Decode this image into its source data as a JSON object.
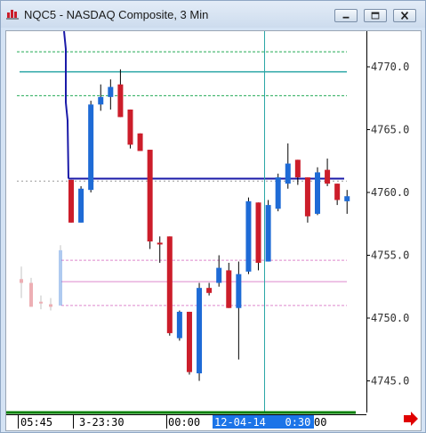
{
  "window": {
    "title": "NQC5 - NASDAQ Composite, 3 Min",
    "buttons": [
      "minimize",
      "restore",
      "close"
    ]
  },
  "price_axis": {
    "labels": [
      "4770.0",
      "4765.0",
      "4760.0",
      "4755.0",
      "4750.0",
      "4745.0"
    ]
  },
  "time_axis": {
    "labels": [
      "05:45",
      "3-23:30",
      "00:00",
      "12-04-14",
      "0:30",
      "00"
    ],
    "highlight_text": "12-04-14   0:30"
  },
  "colors": {
    "bull": "#1e6bd6",
    "bear": "#cc1d2a",
    "current_price_line": "#1a1aa8",
    "cursor_line": "#2aa6a6",
    "upper_levels": "#22aa55",
    "lower_levels": "#dd88cc",
    "time_axis_line": "#008000",
    "highlight_bg": "#1b74e8",
    "arrow": "#e00000"
  },
  "icons": {
    "app": "chart-icon",
    "scroll": "red-right-arrow-icon"
  },
  "chart_data": {
    "type": "candlestick",
    "symbol": "NQC5",
    "interval": "3 Min",
    "ylim": [
      4743.5,
      4773.5
    ],
    "current_price": 4761.1,
    "upper_levels": [
      4771.2,
      4769.6,
      4767.7
    ],
    "lower_levels": [
      4754.6,
      4752.9,
      4751.0
    ],
    "candles": [
      {
        "open": 4761.0,
        "high": 4761.0,
        "low": 4757.6,
        "close": 4757.6
      },
      {
        "open": 4757.6,
        "high": 4760.5,
        "low": 4757.6,
        "close": 4760.3
      },
      {
        "open": 4760.2,
        "high": 4767.3,
        "low": 4760.0,
        "close": 4767.0
      },
      {
        "open": 4767.0,
        "high": 4768.6,
        "low": 4766.5,
        "close": 4767.6
      },
      {
        "open": 4767.6,
        "high": 4769.0,
        "low": 4766.6,
        "close": 4768.4
      },
      {
        "open": 4768.6,
        "high": 4769.8,
        "low": 4766.0,
        "close": 4766.0
      },
      {
        "open": 4766.6,
        "high": 4766.6,
        "low": 4763.5,
        "close": 4763.8
      },
      {
        "open": 4764.7,
        "high": 4764.7,
        "low": 4763.3,
        "close": 4763.3
      },
      {
        "open": 4763.4,
        "high": 4763.4,
        "low": 4755.5,
        "close": 4756.1
      },
      {
        "open": 4756.0,
        "high": 4756.5,
        "low": 4754.4,
        "close": 4755.9
      },
      {
        "open": 4756.5,
        "high": 4756.5,
        "low": 4748.6,
        "close": 4748.8
      },
      {
        "open": 4748.4,
        "high": 4750.6,
        "low": 4748.2,
        "close": 4750.5
      },
      {
        "open": 4750.5,
        "high": 4750.5,
        "low": 4745.5,
        "close": 4745.7
      },
      {
        "open": 4745.6,
        "high": 4752.8,
        "low": 4745.0,
        "close": 4752.4
      },
      {
        "open": 4752.4,
        "high": 4752.8,
        "low": 4751.8,
        "close": 4752.0
      },
      {
        "open": 4752.8,
        "high": 4755.0,
        "low": 4752.5,
        "close": 4754.0
      },
      {
        "open": 4753.8,
        "high": 4754.4,
        "low": 4750.8,
        "close": 4750.8
      },
      {
        "open": 4750.8,
        "high": 4754.5,
        "low": 4746.7,
        "close": 4753.5
      },
      {
        "open": 4753.7,
        "high": 4759.6,
        "low": 4753.5,
        "close": 4759.3
      },
      {
        "open": 4759.2,
        "high": 4759.2,
        "low": 4753.8,
        "close": 4754.4
      },
      {
        "open": 4754.5,
        "high": 4759.4,
        "low": 4754.5,
        "close": 4759.0
      },
      {
        "open": 4758.7,
        "high": 4761.5,
        "low": 4758.5,
        "close": 4761.2
      },
      {
        "open": 4760.7,
        "high": 4763.9,
        "low": 4760.3,
        "close": 4762.3
      },
      {
        "open": 4762.6,
        "high": 4762.6,
        "low": 4760.6,
        "close": 4761.2
      },
      {
        "open": 4761.2,
        "high": 4761.2,
        "low": 4757.6,
        "close": 4758.1
      },
      {
        "open": 4758.3,
        "high": 4762.0,
        "low": 4758.2,
        "close": 4761.6
      },
      {
        "open": 4761.8,
        "high": 4762.7,
        "low": 4760.5,
        "close": 4760.7
      },
      {
        "open": 4760.7,
        "high": 4760.7,
        "low": 4759.0,
        "close": 4759.4
      },
      {
        "open": 4759.3,
        "high": 4760.2,
        "low": 4758.3,
        "close": 4759.7
      }
    ],
    "faded_candles": [
      {
        "open": 4753.1,
        "high": 4754.1,
        "low": 4751.6,
        "close": 4752.8
      },
      {
        "open": 4752.8,
        "high": 4753.2,
        "low": 4750.9,
        "close": 4750.9
      },
      {
        "open": 4751.3,
        "high": 4751.8,
        "low": 4750.7,
        "close": 4751.2
      },
      {
        "open": 4751.1,
        "high": 4751.6,
        "low": 4750.6,
        "close": 4750.9
      },
      {
        "open": 4751.0,
        "high": 4755.8,
        "low": 4751.0,
        "close": 4755.4
      }
    ]
  }
}
